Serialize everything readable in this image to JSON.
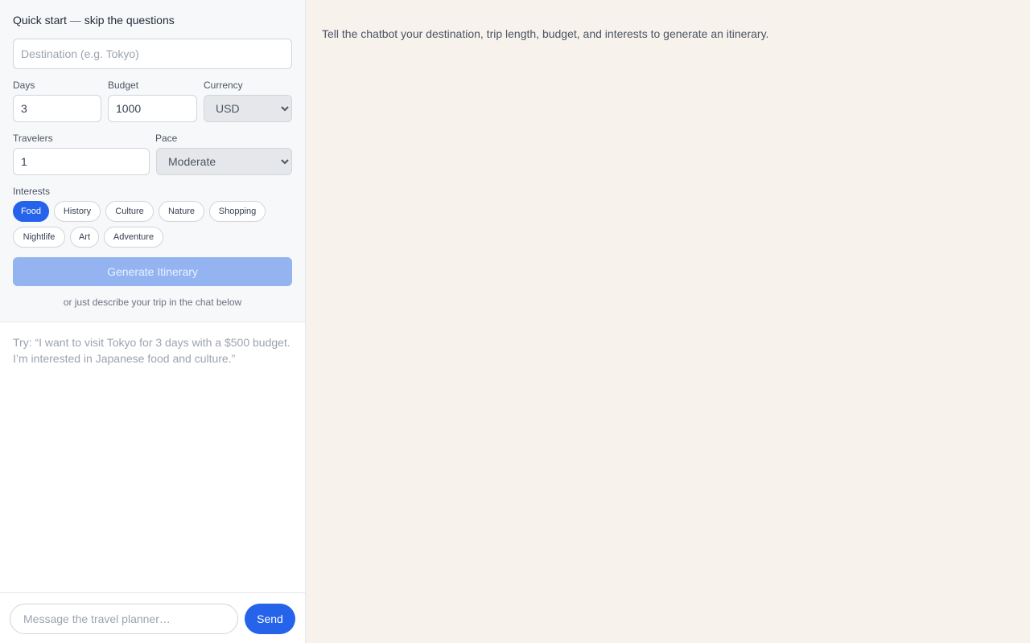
{
  "quick_start": {
    "title": "Quick start",
    "dash": "—",
    "subtitle": "skip the questions",
    "destination_placeholder": "Destination (e.g. Tokyo)",
    "days_label": "Days",
    "days_value": "3",
    "budget_label": "Budget",
    "budget_value": "1000",
    "currency_label": "Currency",
    "currency_value": "USD",
    "travelers_label": "Travelers",
    "travelers_value": "1",
    "pace_label": "Pace",
    "pace_value": "Moderate",
    "interests_label": "Interests",
    "interests": [
      {
        "label": "Food",
        "selected": true
      },
      {
        "label": "History",
        "selected": false
      },
      {
        "label": "Culture",
        "selected": false
      },
      {
        "label": "Nature",
        "selected": false
      },
      {
        "label": "Shopping",
        "selected": false
      },
      {
        "label": "Nightlife",
        "selected": false
      },
      {
        "label": "Art",
        "selected": false
      },
      {
        "label": "Adventure",
        "selected": false
      }
    ],
    "generate_label": "Generate Itinerary",
    "alt_hint": "or just describe your trip in the chat below"
  },
  "chat": {
    "try_hint": "Try: “I want to visit Tokyo for 3 days with a $500 budget. I’m interested in Japanese food and culture.”",
    "input_placeholder": "Message the travel planner…",
    "send_label": "Send"
  },
  "main": {
    "empty_message": "Tell the chatbot your destination, trip length, budget, and interests to generate an itinerary."
  },
  "colors": {
    "accent": "#2563eb",
    "accent_disabled": "#93b4f0",
    "main_bg": "#f7f2ec",
    "sidebar_panel_bg": "#f7f8fa"
  }
}
